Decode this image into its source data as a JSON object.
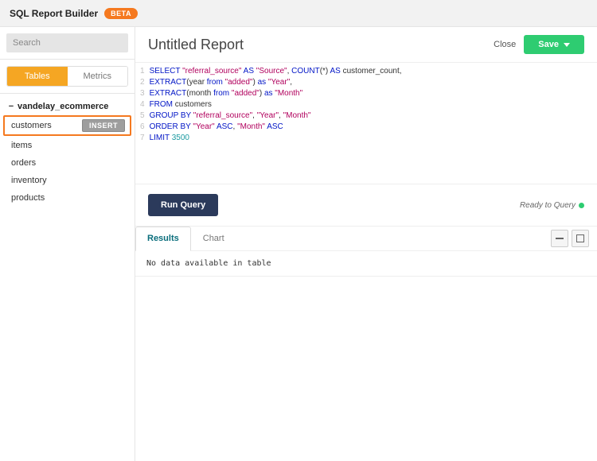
{
  "header": {
    "title": "SQL Report Builder",
    "badge": "BETA"
  },
  "search": {
    "placeholder": "Search"
  },
  "sideTabs": {
    "tables": "Tables",
    "metrics": "Metrics"
  },
  "db": {
    "name": "vandelay_ecommerce",
    "tables": [
      "customers",
      "items",
      "orders",
      "inventory",
      "products"
    ],
    "insert": "INSERT"
  },
  "report": {
    "title": "Untitled Report",
    "close": "Close",
    "save": "Save"
  },
  "code": {
    "l1a": "SELECT ",
    "l1b": "\"referral_source\"",
    "l1c": " AS ",
    "l1d": "\"Source\"",
    "l1e": ", ",
    "l1f": "COUNT",
    "l1g": "(*) ",
    "l1h": "AS",
    "l1i": " customer_count,",
    "l2a": "EXTRACT",
    "l2b": "(year ",
    "l2c": "from",
    "l2d": " \"added\"",
    "l2e": ") ",
    "l2f": "as",
    "l2g": " \"Year\"",
    "l2h": ",",
    "l3a": "EXTRACT",
    "l3b": "(month ",
    "l3c": "from",
    "l3d": " \"added\"",
    "l3e": ") ",
    "l3f": "as",
    "l3g": " \"Month\"",
    "l4a": "FROM",
    "l4b": " customers",
    "l5a": "GROUP BY ",
    "l5b": "\"referral_source\"",
    "l5c": ", ",
    "l5d": "\"Year\"",
    "l5e": ", ",
    "l5f": "\"Month\"",
    "l6a": "ORDER BY ",
    "l6b": "\"Year\"",
    "l6c": " ASC",
    "l6d": ", ",
    "l6e": "\"Month\"",
    "l6f": " ASC",
    "l7a": "LIMIT ",
    "l7b": "3500",
    "ln1": "1",
    "ln2": "2",
    "ln3": "3",
    "ln4": "4",
    "ln5": "5",
    "ln6": "6",
    "ln7": "7"
  },
  "run": {
    "label": "Run Query",
    "status": "Ready to Query"
  },
  "results": {
    "tabResults": "Results",
    "tabChart": "Chart",
    "noData": "No data available in table"
  }
}
